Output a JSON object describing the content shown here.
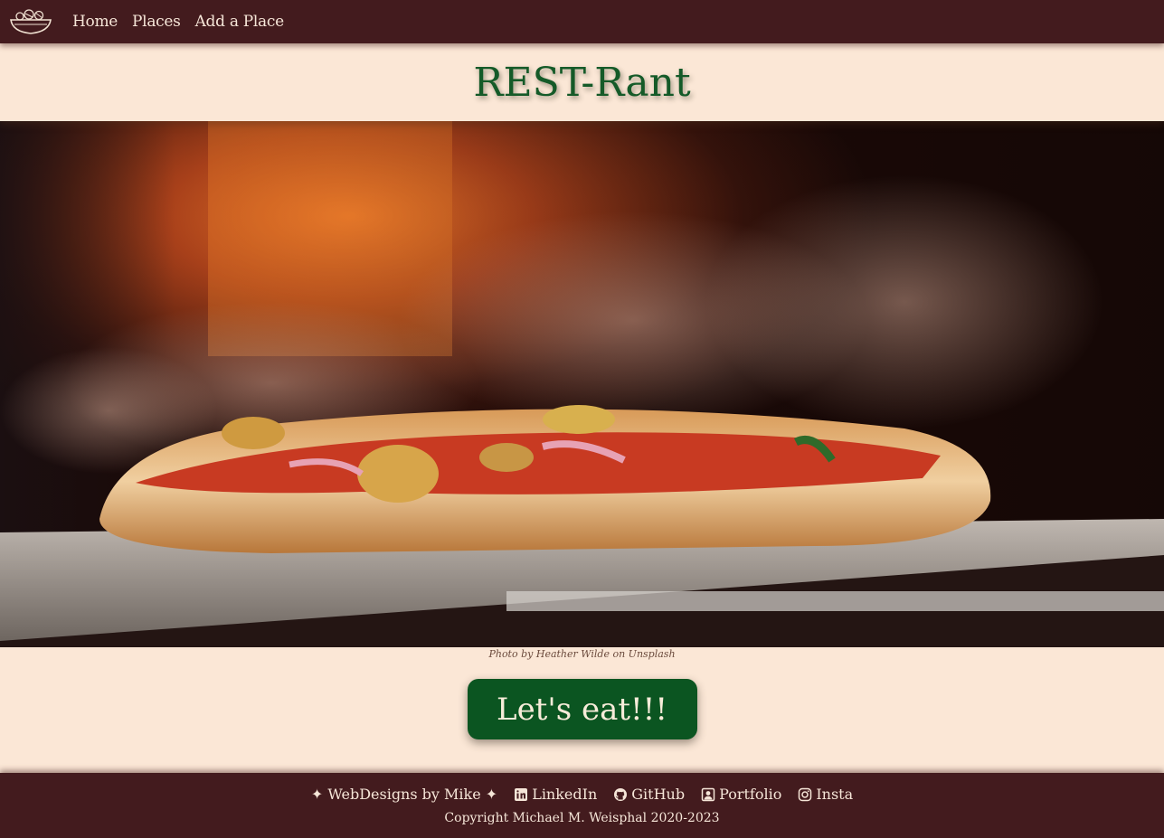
{
  "nav": {
    "logo_icon": "salad-bowl-icon",
    "links": [
      {
        "label": "Home"
      },
      {
        "label": "Places"
      },
      {
        "label": "Add a Place"
      }
    ]
  },
  "header": {
    "title": "REST-Rant"
  },
  "hero": {
    "image": "pizza-in-oven-photo",
    "credit": "Photo by Heather Wilde on Unsplash"
  },
  "cta": {
    "label": "Let's eat!!!"
  },
  "footer": {
    "brand": "✦ WebDesigns by Mike ✦",
    "links": [
      {
        "label": "LinkedIn",
        "icon": "linkedin-icon"
      },
      {
        "label": "GitHub",
        "icon": "github-icon"
      },
      {
        "label": "Portfolio",
        "icon": "portfolio-icon"
      },
      {
        "label": "Insta",
        "icon": "instagram-icon"
      }
    ],
    "copyright": "Copyright Michael M. Weisphal 2020-2023"
  },
  "colors": {
    "nav_bg": "#431b1e",
    "page_bg": "#fbe7d6",
    "title": "#145a28",
    "button_bg": "#0b5521",
    "nav_text": "#f6e6d8"
  }
}
